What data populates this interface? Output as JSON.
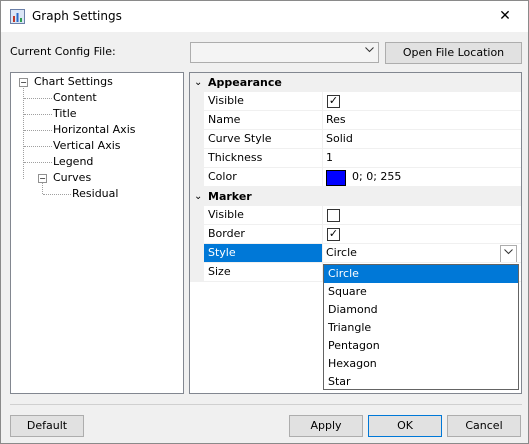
{
  "window": {
    "title": "Graph Settings",
    "close_glyph": "✕"
  },
  "config": {
    "label": "Current Config File:",
    "value": "",
    "open_button": "Open File Location"
  },
  "tree": {
    "root": "Chart Settings",
    "items": [
      "Content",
      "Title",
      "Horizontal Axis",
      "Vertical Axis",
      "Legend"
    ],
    "curves": "Curves",
    "residual": "Residual",
    "expand_glyph": "−"
  },
  "grid": {
    "appearance": {
      "header": "Appearance",
      "visible_label": "Visible",
      "visible_checked": true,
      "name_label": "Name",
      "name_value": "Res",
      "curve_style_label": "Curve Style",
      "curve_style_value": "Solid",
      "thickness_label": "Thickness",
      "thickness_value": "1",
      "color_label": "Color",
      "color_value": "0; 0; 255",
      "color_hex": "#0000ff"
    },
    "marker": {
      "header": "Marker",
      "visible_label": "Visible",
      "visible_checked": false,
      "border_label": "Border",
      "border_checked": true,
      "style_label": "Style",
      "style_value": "Circle",
      "size_label": "Size"
    }
  },
  "style_dropdown": {
    "options": [
      "Circle",
      "Square",
      "Diamond",
      "Triangle",
      "Pentagon",
      "Hexagon",
      "Star"
    ],
    "selected": "Circle"
  },
  "buttons": {
    "default": "Default",
    "apply": "Apply",
    "ok": "OK",
    "cancel": "Cancel"
  },
  "icons": {
    "app": "graph-settings-icon",
    "check_glyph": "✓",
    "collapse_glyph": "⌄",
    "dropdown_glyph": "⌄"
  },
  "colors": {
    "selection": "#0078d7",
    "curve_color": "#0000ff"
  }
}
